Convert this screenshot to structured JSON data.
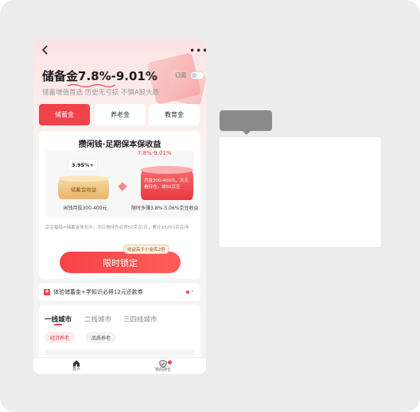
{
  "header": {
    "back_icon": "chevron-left-icon",
    "more_icon": "more-dots-icon",
    "more_label": "•••",
    "title_prefix": "储备金",
    "title_rate": "7.8%-9.01%",
    "subscribe_label": "订阅",
    "subtitle": "储蓄增值首选 历史无亏损 不惧A股大跌"
  },
  "tabs": [
    {
      "label": "储蓄金"
    },
    {
      "label": "养老金"
    },
    {
      "label": "教育金"
    }
  ],
  "card": {
    "title": "攒闲钱·足期保本保收益",
    "left_badge": "3.95%+",
    "left_block": "储蓄金收益",
    "left_label": "闲钱月投300-400元",
    "right_rate": "7.8%-9.01%",
    "right_block": "月投300-400元，天天看持仓，领50京豆",
    "right_label": "限时多赚3.8%-5.06%京豆收益",
    "note": "京豆福借=储蓄金体验中，次日看持仓必得50京豆/日，累计18250京豆/年",
    "tip": "收益高于小金库2倍",
    "button_label": "限时锁定"
  },
  "promo": {
    "icon": "gift-icon",
    "text": "体验储蓄金+学知识必得12元还款券"
  },
  "city": {
    "tabs": [
      {
        "label": "一线城市"
      },
      {
        "label": "二线城市"
      },
      {
        "label": "三四线城市"
      }
    ],
    "chips": [
      {
        "label": "经济养老"
      },
      {
        "label": "品质养老"
      }
    ]
  },
  "tabbar": [
    {
      "label": "首页",
      "icon": "home-icon"
    },
    {
      "label": "我的持仓",
      "icon": "shield-check-icon"
    }
  ],
  "colors": {
    "accent": "#f0424a",
    "gold": "#eab46a"
  }
}
